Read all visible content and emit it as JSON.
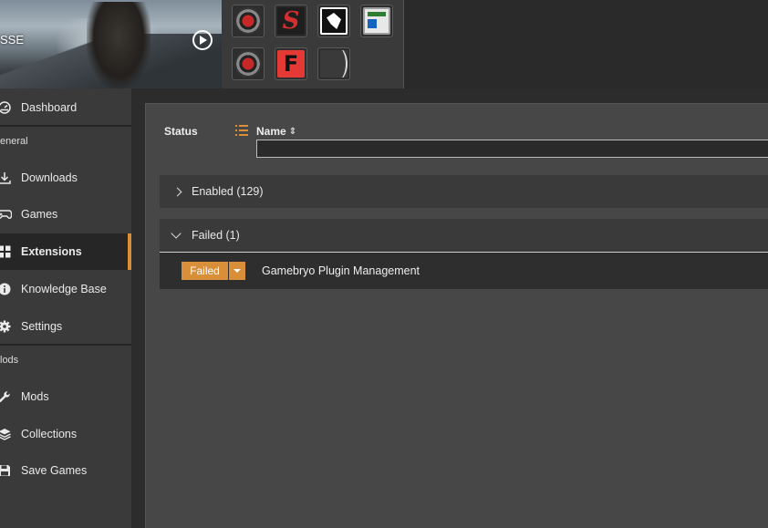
{
  "game": {
    "label": "SSE"
  },
  "tools": [
    {
      "icon": "crosshair-gear-icon"
    },
    {
      "icon": "script-extender-s-icon"
    },
    {
      "icon": "dragon-icon"
    },
    {
      "icon": "window-app-icon"
    },
    {
      "icon": "crosshair-gear-icon"
    },
    {
      "icon": "f-letter-icon"
    },
    {
      "icon": "curve-icon"
    }
  ],
  "sidebar": {
    "items": [
      {
        "label": "Dashboard",
        "icon": "dashboard-icon"
      },
      {
        "label": "Downloads",
        "icon": "download-icon"
      },
      {
        "label": "Games",
        "icon": "gamepad-icon"
      },
      {
        "label": "Extensions",
        "icon": "extensions-grid-icon",
        "active": true
      },
      {
        "label": "Knowledge Base",
        "icon": "info-icon"
      },
      {
        "label": "Settings",
        "icon": "gear-icon"
      },
      {
        "label": "Mods",
        "icon": "wrench-icon"
      },
      {
        "label": "Collections",
        "icon": "layers-icon"
      },
      {
        "label": "Save Games",
        "icon": "save-icon"
      }
    ],
    "sections": {
      "general": "eneral",
      "mods": "lods"
    }
  },
  "table": {
    "columns": {
      "status": "Status",
      "name": "Name"
    },
    "filter_value": ""
  },
  "groups": [
    {
      "label": "Enabled (129)",
      "expanded": false
    },
    {
      "label": "Failed (1)",
      "expanded": true
    }
  ],
  "extensions": [
    {
      "status": "Failed",
      "name": "Gamebryo Plugin Management"
    }
  ],
  "colors": {
    "accent": "#d98e3a",
    "panel": "#474747",
    "sidebar": "#3a3a3a"
  }
}
